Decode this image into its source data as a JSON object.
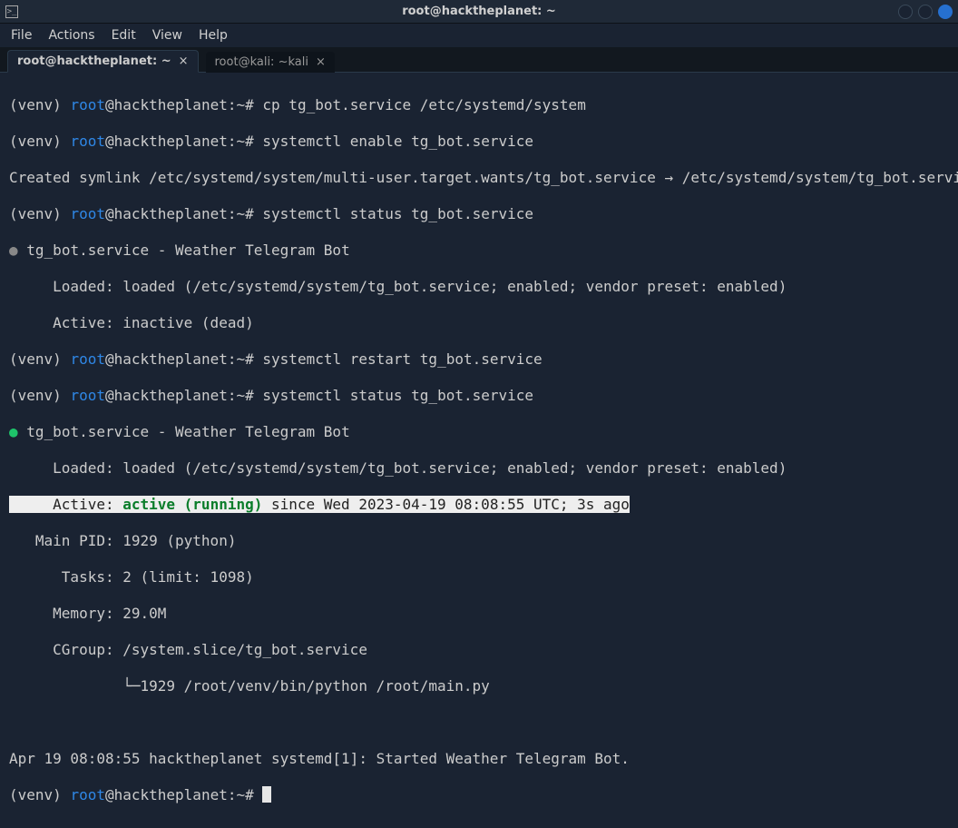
{
  "titlebar": {
    "title": "root@hacktheplanet: ~"
  },
  "menu": {
    "file": "File",
    "actions": "Actions",
    "edit": "Edit",
    "view": "View",
    "help": "Help"
  },
  "tabs": [
    {
      "label": "root@hacktheplanet: ~",
      "close": "×"
    },
    {
      "label": "root@kali: ~kali",
      "close": "×"
    }
  ],
  "prompt": {
    "venv": "(venv)",
    "user": "root",
    "at": "@",
    "host": "hacktheplanet",
    "colon": ":",
    "path": "~",
    "hash": "#"
  },
  "cmds": {
    "cp": "cp tg_bot.service /etc/systemd/system",
    "enable": "systemctl enable tg_bot.service",
    "status1": "systemctl status tg_bot.service",
    "restart": "systemctl restart tg_bot.service",
    "status2": "systemctl status tg_bot.service"
  },
  "out": {
    "symlink": "Created symlink /etc/systemd/system/multi-user.target.wants/tg_bot.service → /etc/systemd/system/tg_bot.service.",
    "svc_header": "tg_bot.service - Weather Telegram Bot",
    "loaded": "     Loaded: loaded (/etc/systemd/system/tg_bot.service; enabled; vendor preset: enabled)",
    "inactive": "     Active: inactive (dead)",
    "active_label": "     Active: ",
    "active_value": "active (running)",
    "active_since": " since Wed 2023-04-19 08:08:55 UTC; 3s ago",
    "mainpid": "   Main PID: 1929 (python)",
    "tasks": "      Tasks: 2 (limit: 1098)",
    "memory": "     Memory: 29.0M",
    "cgroup": "     CGroup: /system.slice/tg_bot.service",
    "cgroup2": "             └─1929 /root/venv/bin/python /root/main.py",
    "journal": "Apr 19 08:08:55 hacktheplanet systemd[1]: Started Weather Telegram Bot."
  }
}
